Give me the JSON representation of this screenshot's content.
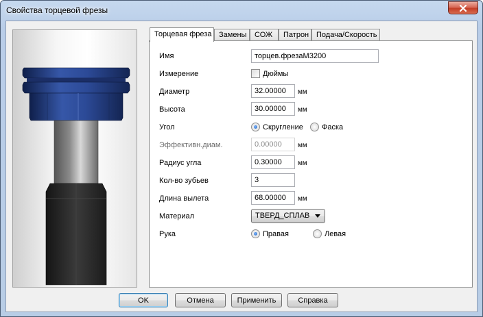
{
  "window": {
    "title": "Свойства торцевой фрезы",
    "close_icon": "close-icon"
  },
  "tabs": [
    {
      "label": "Торцевая фреза",
      "active": true
    },
    {
      "label": "Замены",
      "active": false
    },
    {
      "label": "СОЖ",
      "active": false
    },
    {
      "label": "Патрон",
      "active": false
    },
    {
      "label": "Подача/Скорость",
      "active": false
    }
  ],
  "form": {
    "name": {
      "label": "Имя",
      "value": "торцев.фрезаМ3200"
    },
    "measure": {
      "label": "Измерение",
      "checkbox_label": "Дюймы",
      "checked": false
    },
    "diameter": {
      "label": "Диаметр",
      "value": "32.00000",
      "unit": "мм"
    },
    "height": {
      "label": "Высота",
      "value": "30.00000",
      "unit": "мм"
    },
    "angle": {
      "label": "Угол",
      "option_round": "Скругление",
      "option_chamfer": "Фаска",
      "selected": "Скругление"
    },
    "eff_diam": {
      "label": "Эффективн.диам.",
      "value": "0.00000",
      "unit": "мм",
      "disabled": true
    },
    "corner_radius": {
      "label": "Радиус угла",
      "value": "0.30000",
      "unit": "мм"
    },
    "teeth": {
      "label": "Кол-во зубьев",
      "value": "3"
    },
    "overhang": {
      "label": "Длина вылета",
      "value": "68.00000",
      "unit": "мм"
    },
    "material": {
      "label": "Материал",
      "value": "ТВЕРД_СПЛАВ"
    },
    "hand": {
      "label": "Рука",
      "option_right": "Правая",
      "option_left": "Левая",
      "selected": "Правая"
    }
  },
  "buttons": {
    "ok": "OK",
    "cancel": "Отмена",
    "apply": "Применить",
    "help": "Справка"
  },
  "colors": {
    "tool_head": "#2f4f9a",
    "shank": "#9a9a9a",
    "holder": "#2f2f2f"
  }
}
